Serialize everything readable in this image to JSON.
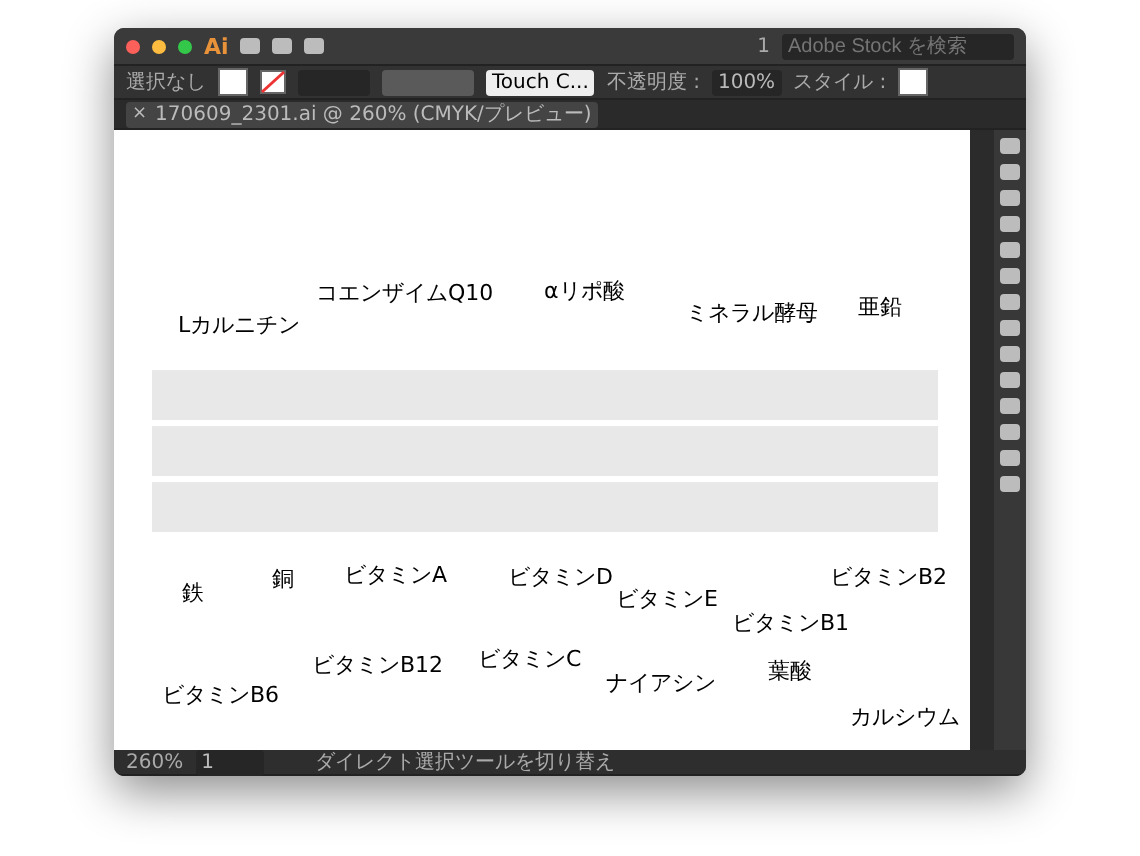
{
  "title_bar": {
    "app_logo": "Ai",
    "page_number": "1",
    "search": {
      "placeholder": "Adobe Stock を検索"
    }
  },
  "control_bar": {
    "selection": "選択なし",
    "brush": "Touch C...",
    "opacity_label": "不透明度 :",
    "opacity_value": "100%",
    "style_label": "スタイル :"
  },
  "document_tab": {
    "close": "×",
    "title": "170609_2301.ai @ 260% (CMYK/プレビュー)",
    "selected": true
  },
  "artboard": {
    "labels": [
      {
        "text": "Lカルニチン"
      },
      {
        "text": "コエンザイムQ10"
      },
      {
        "text": "αリポ酸"
      },
      {
        "text": "ミネラル酵母"
      },
      {
        "text": "亜鉛"
      },
      {
        "text": "鉄"
      },
      {
        "text": "銅"
      },
      {
        "text": "ビタミンA"
      },
      {
        "text": "ビタミンD"
      },
      {
        "text": "ビタミンE"
      },
      {
        "text": "ビタミンB2"
      },
      {
        "text": "ビタミンB1"
      },
      {
        "text": "ビタミンB12"
      },
      {
        "text": "ビタミンC"
      },
      {
        "text": "ナイアシン"
      },
      {
        "text": "葉酸"
      },
      {
        "text": "ビタミンB6"
      },
      {
        "text": "カルシウム"
      }
    ]
  },
  "status_bar": {
    "zoom": "260%",
    "artboard_number": "1",
    "status": "ダイレクト選択ツールを切り替え"
  }
}
